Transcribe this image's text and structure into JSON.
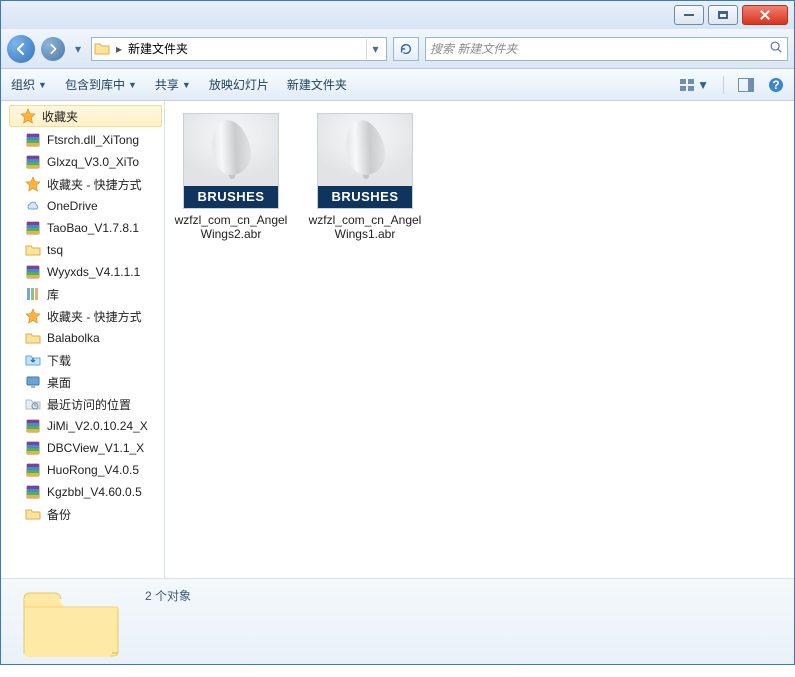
{
  "titlebar": {},
  "nav": {
    "path_label": "新建文件夹",
    "search_placeholder": "搜索 新建文件夹"
  },
  "toolbar": {
    "organize": "组织",
    "include_in_library": "包含到库中",
    "share": "共享",
    "slideshow": "放映幻灯片",
    "new_folder": "新建文件夹"
  },
  "sidebar": {
    "header": "收藏夹",
    "items": [
      {
        "label": "Ftsrch.dll_XiTong",
        "icon": "rar"
      },
      {
        "label": "Glxzq_V3.0_XiTo",
        "icon": "rar"
      },
      {
        "label": "收藏夹 - 快捷方式",
        "icon": "star"
      },
      {
        "label": "OneDrive",
        "icon": "onedrive"
      },
      {
        "label": "TaoBao_V1.7.8.1",
        "icon": "rar"
      },
      {
        "label": "tsq",
        "icon": "folder"
      },
      {
        "label": "Wyyxds_V4.1.1.1",
        "icon": "rar"
      },
      {
        "label": "库",
        "icon": "lib"
      },
      {
        "label": "收藏夹 - 快捷方式",
        "icon": "star"
      },
      {
        "label": "Balabolka",
        "icon": "folder"
      },
      {
        "label": "下载",
        "icon": "download"
      },
      {
        "label": "桌面",
        "icon": "desktop"
      },
      {
        "label": "最近访问的位置",
        "icon": "recent"
      },
      {
        "label": "JiMi_V2.0.10.24_X",
        "icon": "rar"
      },
      {
        "label": "DBCView_V1.1_X",
        "icon": "rar"
      },
      {
        "label": "HuoRong_V4.0.5",
        "icon": "rar"
      },
      {
        "label": "Kgzbbl_V4.60.0.5",
        "icon": "rar"
      },
      {
        "label": "备份",
        "icon": "folder"
      }
    ]
  },
  "files": [
    {
      "name": "wzfzl_com_cn_AngelWings2.abr",
      "badge": "BRUSHES"
    },
    {
      "name": "wzfzl_com_cn_AngelWings1.abr",
      "badge": "BRUSHES"
    }
  ],
  "status": {
    "count_text": "2 个对象"
  }
}
